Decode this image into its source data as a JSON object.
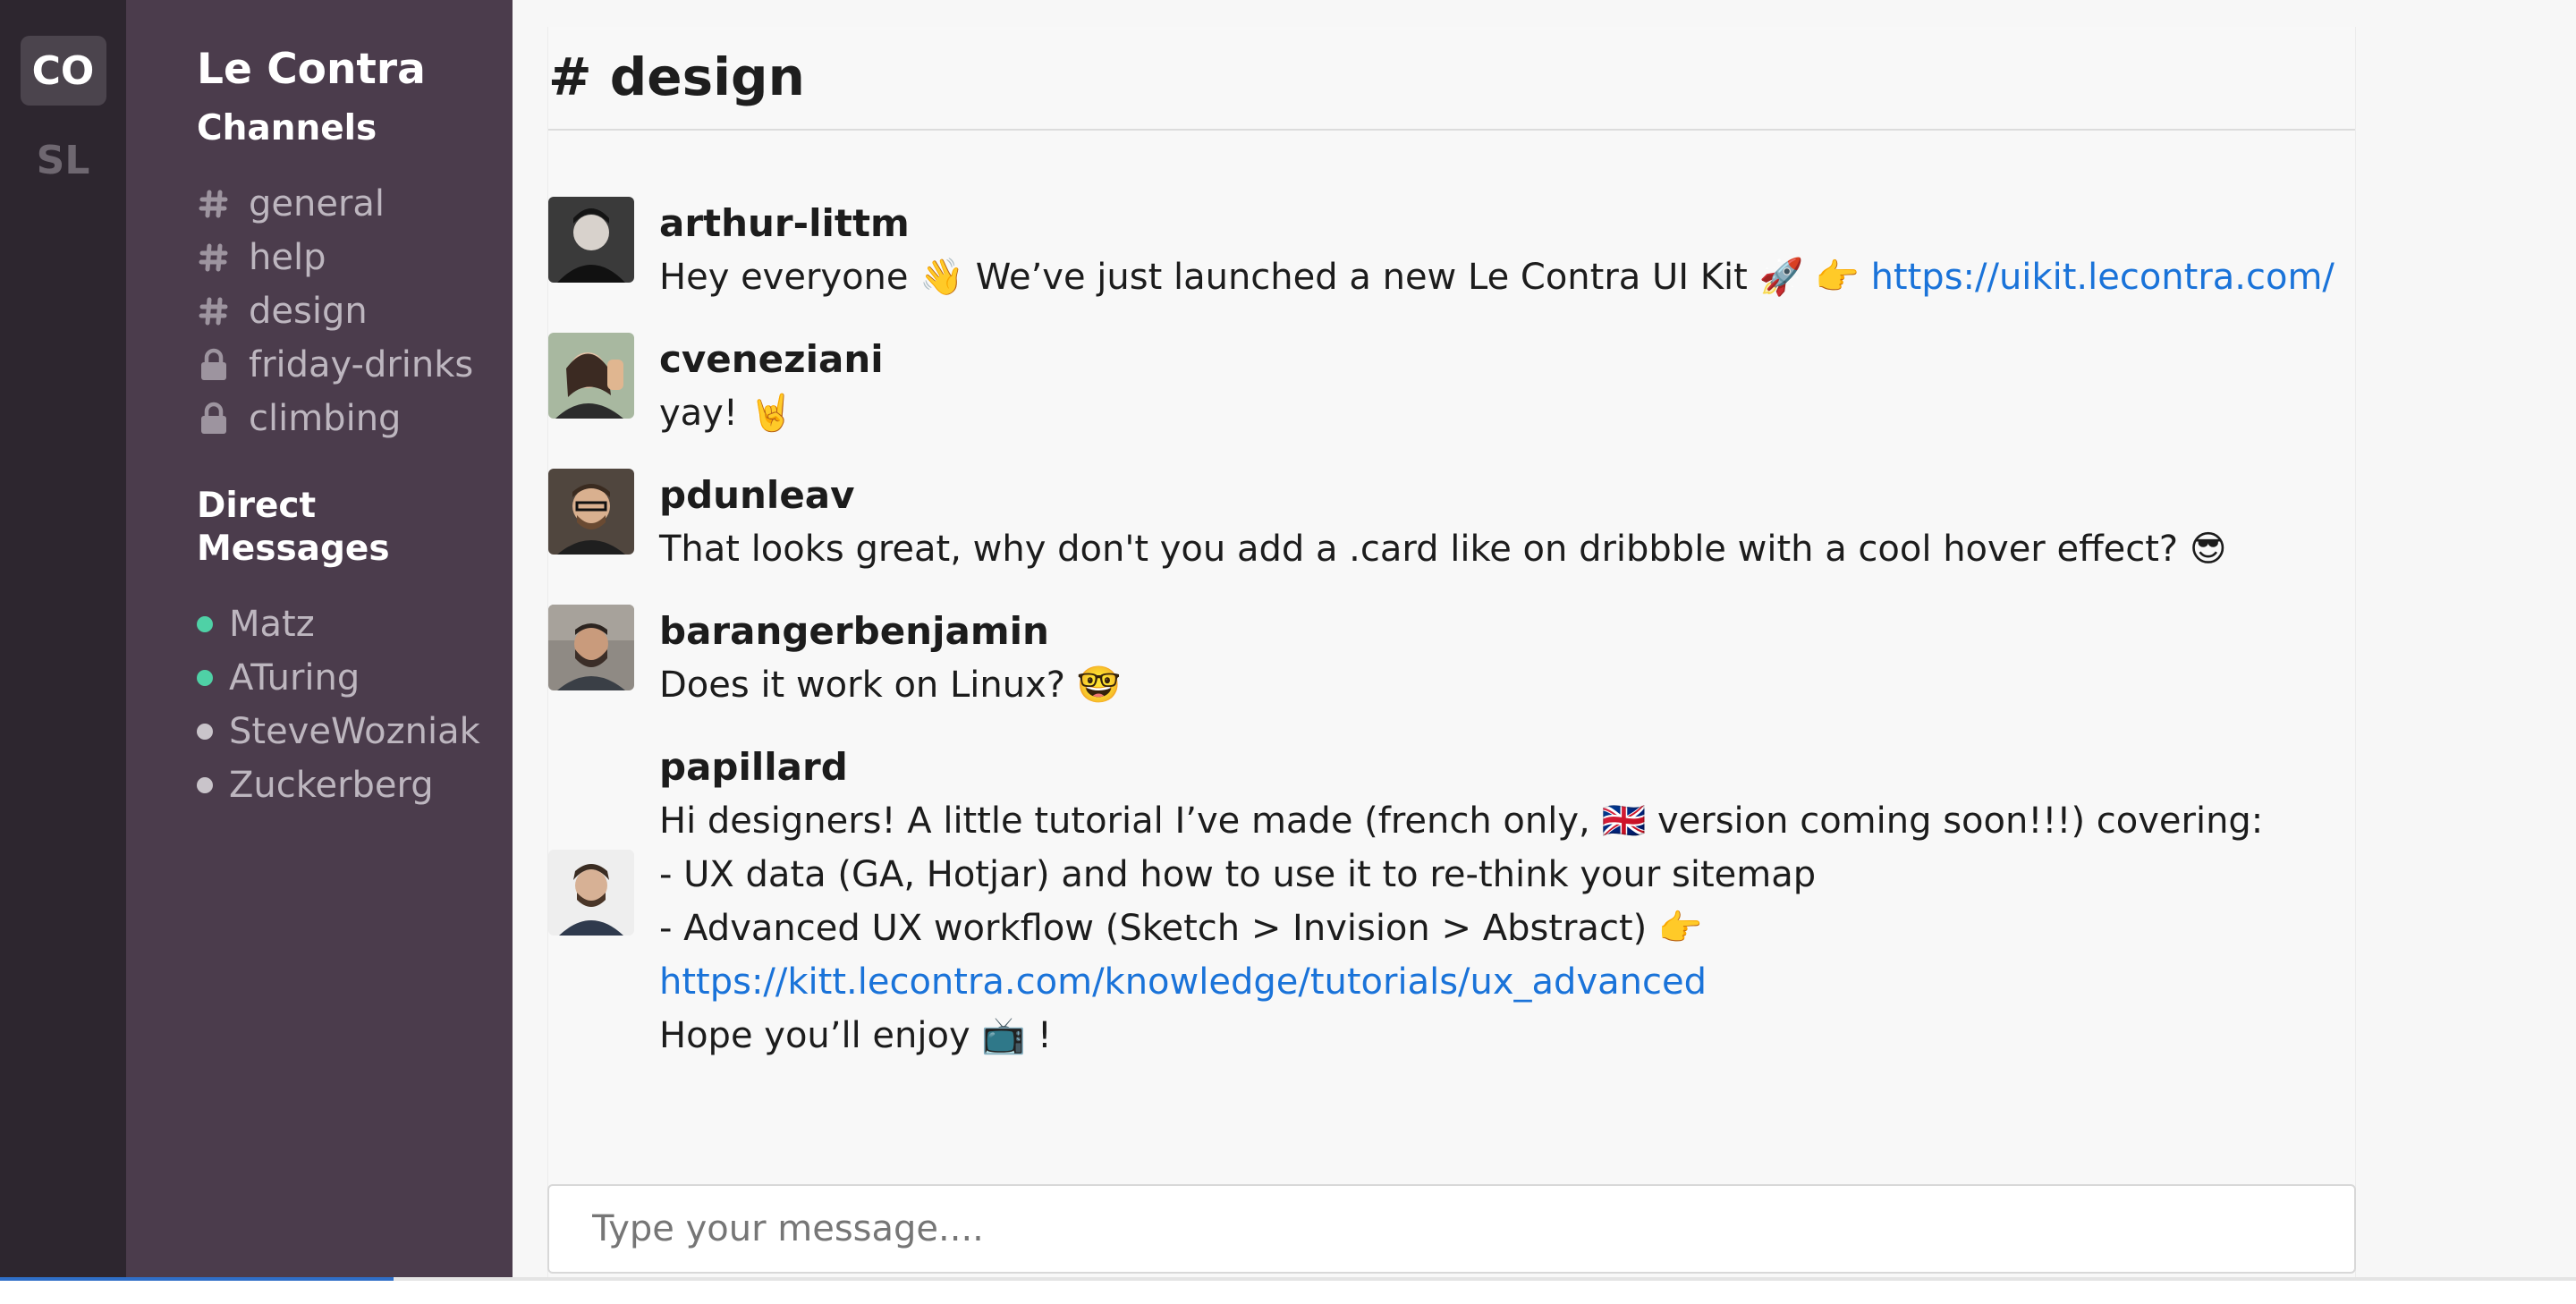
{
  "workspaces": [
    {
      "label": "CO",
      "active": true
    },
    {
      "label": "SL",
      "active": false
    }
  ],
  "sidebar": {
    "team_name": "Le Contra",
    "channels_title": "Channels",
    "channels": [
      {
        "name": "general",
        "icon": "hashtag-icon"
      },
      {
        "name": "help",
        "icon": "hashtag-icon"
      },
      {
        "name": "design",
        "icon": "hashtag-icon"
      },
      {
        "name": "friday-drinks",
        "icon": "lock-icon"
      },
      {
        "name": "climbing",
        "icon": "lock-icon"
      }
    ],
    "dm_title": "Direct Messages",
    "direct_messages": [
      {
        "name": "Matz",
        "status": "online",
        "status_color": "#4fd1a6"
      },
      {
        "name": "ATuring",
        "status": "online",
        "status_color": "#4fd1a6"
      },
      {
        "name": "SteveWozniak",
        "status": "offline",
        "status_color": "#c9c4ca"
      },
      {
        "name": "Zuckerberg",
        "status": "offline",
        "status_color": "#c9c4ca"
      }
    ]
  },
  "channel": {
    "title": "# design"
  },
  "messages": [
    {
      "author": "arthur-littm",
      "lines": [
        {
          "text": "Hey everyone 👋 We’ve just launched a new Le Contra UI Kit 🚀 👉 ",
          "link": "https://uikit.lecontra.com/"
        }
      ]
    },
    {
      "author": "cveneziani",
      "lines": [
        {
          "text": "yay! 🤘"
        }
      ]
    },
    {
      "author": "pdunleav",
      "lines": [
        {
          "text": "That looks great, why don't you add a .card like on dribbble with a cool hover effect? 😎"
        }
      ]
    },
    {
      "author": "barangerbenjamin",
      "lines": [
        {
          "text": "Does it work on Linux? 🤓"
        }
      ]
    },
    {
      "author": "papillard",
      "lines": [
        {
          "text": "Hi designers! A little tutorial I’ve made (french only, 🇬🇧 version coming soon!!!) covering:"
        },
        {
          "text": "- UX data (GA, Hotjar) and how to use it to re-think your sitemap"
        },
        {
          "text": "- Advanced UX workflow (Sketch > Invision > Abstract) 👉"
        },
        {
          "text": "",
          "link": "https://kitt.lecontra.com/knowledge/tutorials/ux_advanced"
        },
        {
          "text": "Hope you’ll enjoy 📺 !"
        }
      ]
    }
  ],
  "composer": {
    "placeholder": "Type your message...."
  },
  "colors": {
    "rail": "#2d262f",
    "sidebar": "#4b3c4c",
    "link": "#1a73d9",
    "online": "#4fd1a6"
  }
}
